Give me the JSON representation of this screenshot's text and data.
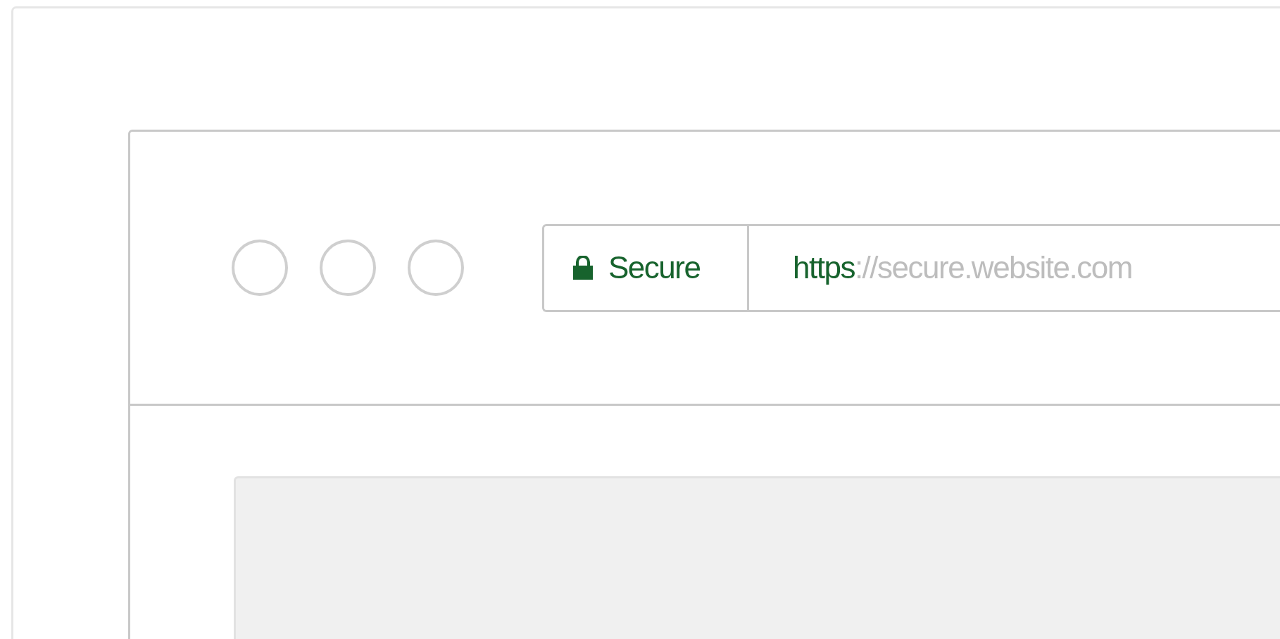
{
  "window": {
    "controls": [
      {
        "kind": "circle"
      },
      {
        "kind": "circle"
      },
      {
        "kind": "circle"
      }
    ]
  },
  "address_bar": {
    "security_label": "Secure",
    "url_scheme": "https",
    "url_rest": "://secure.website.com"
  },
  "content": {
    "kind": "placeholder-panel"
  }
}
